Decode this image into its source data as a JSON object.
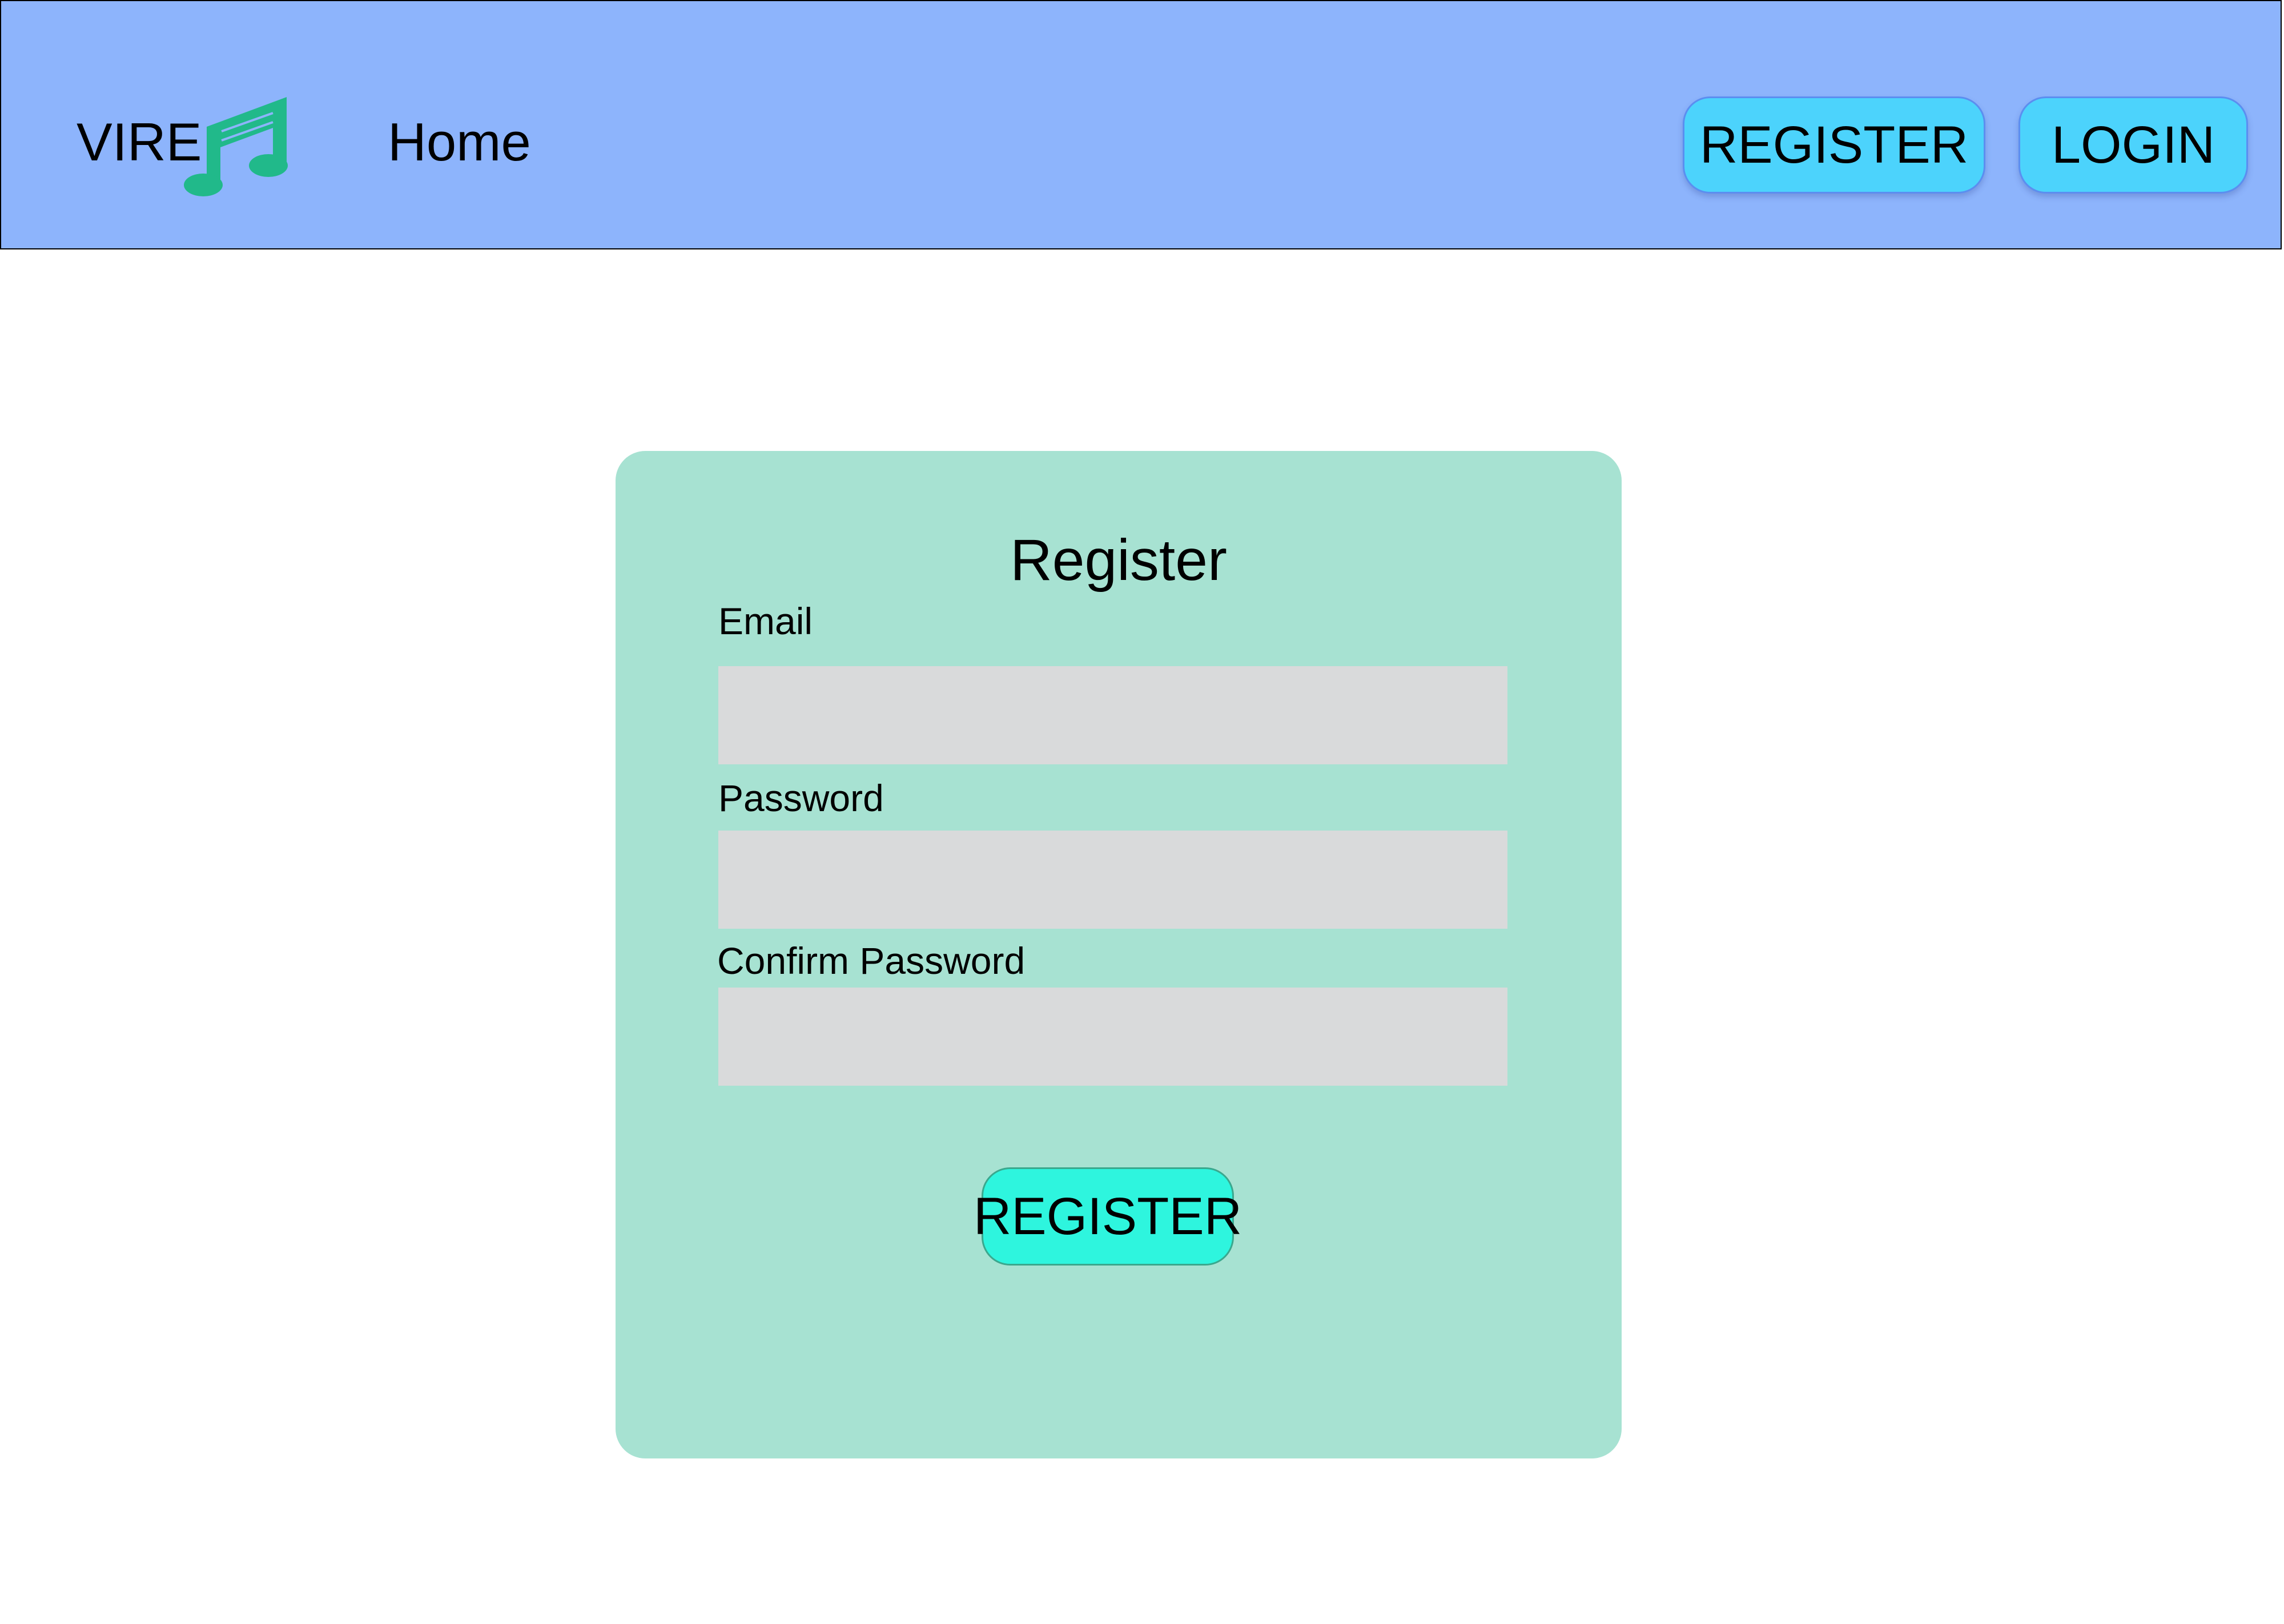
{
  "header": {
    "brand": "VIRE",
    "logo_icon": "music-note-icon",
    "home_link": "Home",
    "register_button": "REGISTER",
    "login_button": "LOGIN"
  },
  "form": {
    "title": "Register",
    "email_label": "Email",
    "email_value": "",
    "password_label": "Password",
    "password_value": "",
    "confirm_password_label": "Confirm Password",
    "confirm_password_value": "",
    "submit_button": "REGISTER"
  },
  "colors": {
    "navbar_background": "#8db4fc",
    "nav_button": "#4cd3fc",
    "card_background": "#a7e2d2",
    "input_background": "#d9dadb",
    "submit_button": "#2ef5de",
    "logo": "#21b98a"
  }
}
